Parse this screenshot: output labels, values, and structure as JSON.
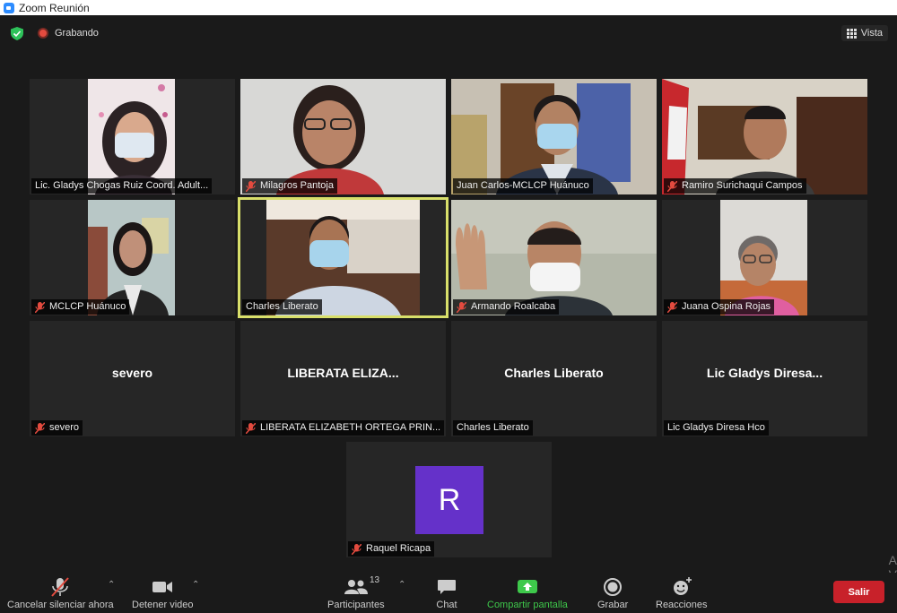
{
  "window": {
    "title": "Zoom Reunión"
  },
  "topbar": {
    "recording_label": "Grabando",
    "view_label": "Vista"
  },
  "participants": [
    {
      "name": "Lic. Gladys Chogas Ruiz  Coord. Adult...",
      "muted": false
    },
    {
      "name": "Milagros Pantoja",
      "muted": true
    },
    {
      "name": "Juan Carlos-MCLCP Huánuco",
      "muted": false
    },
    {
      "name": "Ramiro Surichaqui Campos",
      "muted": true
    },
    {
      "name": "MCLCP Huánuco",
      "muted": true
    },
    {
      "name": "Charles Liberato",
      "muted": false
    },
    {
      "name": "Armando Roalcaba",
      "muted": true
    },
    {
      "name": "Juana Ospina Rojas",
      "muted": true
    },
    {
      "name": "severo",
      "display_name": "severo",
      "muted": true
    },
    {
      "name": "LIBERATA ELIZABETH ORTEGA PRIN...",
      "display_name": "LIBERATA  ELIZA...",
      "muted": true
    },
    {
      "name": "Charles Liberato",
      "display_name": "Charles Liberato",
      "muted": false
    },
    {
      "name": "Lic Gladys Diresa Hco",
      "display_name": "Lic Gladys Diresa...",
      "muted": false
    },
    {
      "name": "Raquel Ricapa",
      "avatar_letter": "R",
      "avatar_color": "#6531c9",
      "muted": true
    }
  ],
  "toolbar": {
    "unmute": "Cancelar silenciar ahora",
    "stop_video": "Detener video",
    "participants": "Participantes",
    "participants_count": "13",
    "chat": "Chat",
    "share_screen": "Compartir pantalla",
    "record": "Grabar",
    "reactions": "Reacciones",
    "leave": "Salir"
  },
  "colors": {
    "active_speaker_border": "#d8df6a",
    "share_green": "#3ec94b",
    "leave_red": "#c8212a",
    "recording_red": "#e34b3f"
  },
  "edge_text": "A\nV"
}
